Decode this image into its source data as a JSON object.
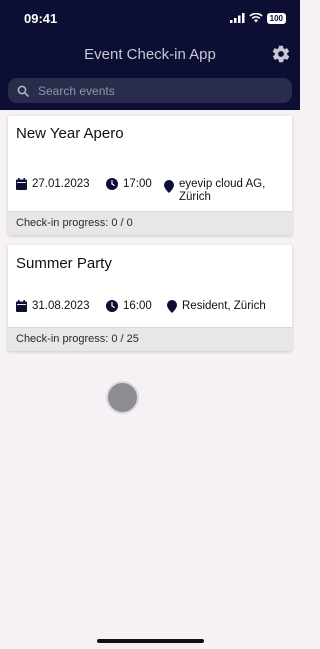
{
  "status_bar": {
    "time": "09:41",
    "battery": "100"
  },
  "header": {
    "title": "Event Check-in App",
    "settings_icon": "gear-icon"
  },
  "search": {
    "placeholder": "Search events",
    "value": ""
  },
  "events": [
    {
      "title": "New Year Apero",
      "date": "27.01.2023",
      "time": "17:00",
      "location_line1": "eyevip cloud AG,",
      "location_line2": "Zürich",
      "progress": "Check-in progress: 0 / 0"
    },
    {
      "title": "Summer Party",
      "date": "31.08.2023",
      "time": "16:00",
      "location_line1": "Resident, Zürich",
      "location_line2": "",
      "progress": "Check-in progress: 0 / 25"
    }
  ],
  "colors": {
    "header_bg": "#0c0f33",
    "page_bg": "#f6f1f4",
    "search_bg": "#2a2c4c",
    "icon_color": "#0c0f33"
  }
}
